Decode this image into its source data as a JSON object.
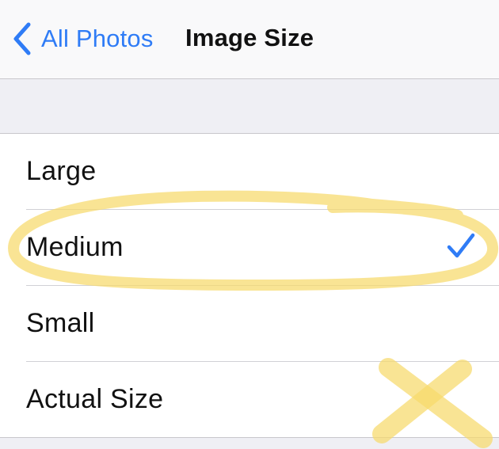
{
  "nav": {
    "back_label": "All Photos",
    "title": "Image Size"
  },
  "options": [
    {
      "label": "Large",
      "selected": false
    },
    {
      "label": "Medium",
      "selected": true
    },
    {
      "label": "Small",
      "selected": false
    },
    {
      "label": "Actual Size",
      "selected": false
    }
  ],
  "colors": {
    "accent": "#2f7cf6",
    "highlight": "#f7d96b"
  },
  "icons": {
    "back": "chevron-left-icon",
    "selected": "checkmark-icon"
  }
}
